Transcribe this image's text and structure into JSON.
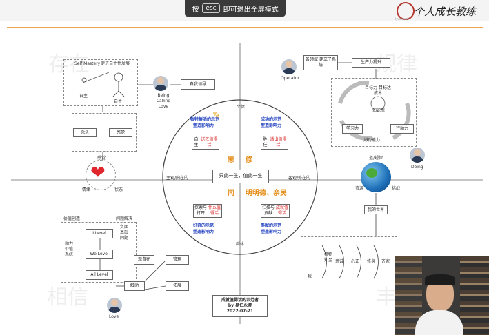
{
  "toolbar": {
    "hint_prefix": "按",
    "hint_key": "esc",
    "hint_suffix": "即可退出全屏模式"
  },
  "brand": {
    "name": "个人成长教练"
  },
  "watermarks": {
    "tl": "存在",
    "tr": "规律",
    "bl": "相信",
    "br": "丰"
  },
  "self_mastery": {
    "title": "Self Mastery",
    "subtitle": "促进自主性发展",
    "self_small": "自主",
    "self_big": "自主",
    "thought": "念头",
    "feeling": "感觉",
    "persona": "Being Calling Love",
    "self_lead": "自我领导"
  },
  "heart": {
    "top": "感觉",
    "left": "情绪",
    "right": "状态"
  },
  "operator": {
    "label": "Operator",
    "box1": "各领域 建立子系统",
    "box2": "生产力提升",
    "goal": "目标力 目标达成术",
    "knowledge": "知识库",
    "learn": "学习力",
    "action": "行动力",
    "cognition": "认知/能力"
  },
  "earth": {
    "top": "道/规律",
    "left": "资源",
    "right": "挑战",
    "persona": "Doing",
    "myworld": "我的世界"
  },
  "circle": {
    "center": "只此一生，值此一生",
    "top": "个体",
    "bottom": "群体",
    "left": "主观/内在的",
    "right": "客观/外在的",
    "q1a": "独特鲜活的示范",
    "q1b": "塑造影响力",
    "q1c": "自主",
    "q1d": "送阵值得活",
    "q2a": "成功的示范",
    "q2b": "塑造影响力",
    "q2c": "胜任",
    "q2d": "活出值得活",
    "q3a": "探索与打开",
    "q3b": "什么值得活",
    "q3c": "好奇的示范",
    "q3d": "塑造影响力",
    "q4a": "扫描与贡献",
    "q4b": "成就值得活",
    "q4c": "奉献的示范",
    "q4d": "塑造影响力",
    "o1": "思",
    "o2": "修",
    "o3": "闻",
    "o4": "明明德、亲民"
  },
  "levels": {
    "head1": "价值创造",
    "head2": "问题解决",
    "col1": "动力价值系统",
    "col2": "负面基础问题",
    "l1": "I Level",
    "l2": "We Level",
    "l3": "All Level",
    "persona": "Love"
  },
  "flow": {
    "a": "触动",
    "b": "现自在",
    "c": "管理",
    "d": "拓展"
  },
  "footer": {
    "l1": "成就值得活的示范者",
    "l2": "by 易仁永澄",
    "l3": "2022-07-21"
  },
  "steps": {
    "me": "我",
    "s1": "格物 知至",
    "s2": "意诚",
    "s3": "心正",
    "s4": "修身",
    "s5": "齐家",
    "s6": "治"
  }
}
